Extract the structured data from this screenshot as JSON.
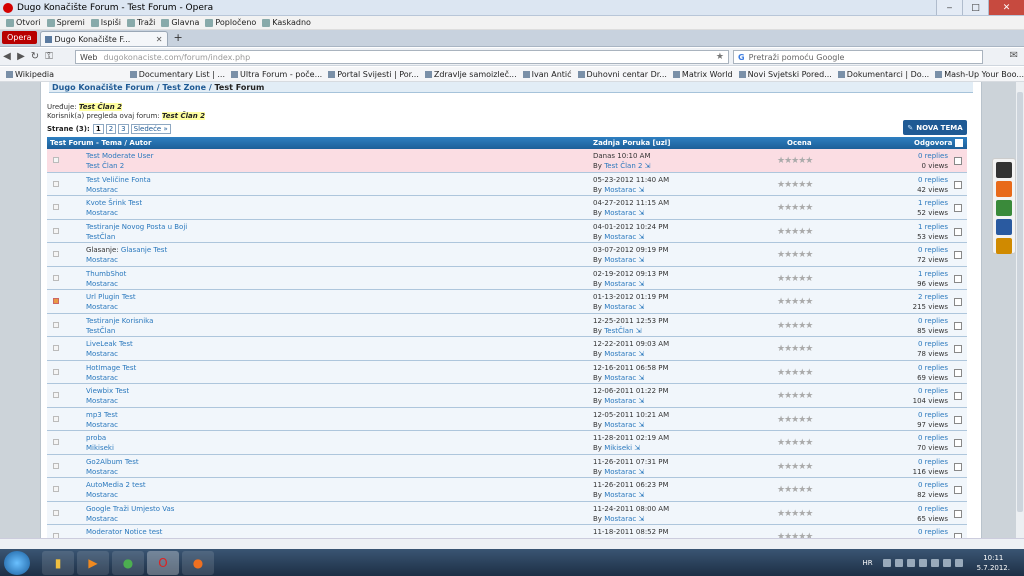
{
  "window": {
    "title": "Dugo Konačište Forum - Test Forum - Opera"
  },
  "menu": [
    "Otvori",
    "Spremi",
    "Ispiši",
    "Traži",
    "Glavna",
    "Popločeno",
    "Kaskadno"
  ],
  "browser": {
    "opera_label": "Opera",
    "tab_title": "Dugo Konačište F...",
    "web_label": "Web",
    "url": "dugokonaciste.com/forum/index.php",
    "search_placeholder": "Pretraži pomoću Google"
  },
  "bookmarks": [
    "Wikipedia",
    "",
    "Documentary List | ...",
    "Ultra Forum - poče...",
    "Portal Svijesti | Por...",
    "Zdravlje samoizleč...",
    "Ivan Antić",
    "Duhovni centar Dr...",
    "Matrix World",
    "Novi Svjetski Pored...",
    "Dokumentarci | Do...",
    "Mash-Up Your Boo..."
  ],
  "breadcrumb": {
    "root": "Dugo Konačište Forum",
    "parent": "Test Zone",
    "current": "Test Forum",
    "sep": "/"
  },
  "moderators": {
    "label": "Uređuje:",
    "name": "Test Član 2",
    "viewing_text": "Korisnik(a) pregleda ovaj forum:",
    "viewer": "Test Član 2"
  },
  "pagination": {
    "label": "Strane (3):",
    "pages": [
      "1",
      "2",
      "3"
    ],
    "next": "Sledeće »"
  },
  "new_topic_label": "NOVA TEMA",
  "table_header": {
    "topic": "Test Forum - Tema / Autor",
    "last_post": "Zadnja Poruka [uzl]",
    "rating": "Ocena",
    "replies": "Odgovora"
  },
  "topics": [
    {
      "title": "Test Moderate User",
      "author": "Test Član 2",
      "date": "Danas 10:10 AM",
      "by": "Test Član 2",
      "replies": "0 replies",
      "views": "0 views"
    },
    {
      "title": "Test Veličine Fonta",
      "author": "Mostarac",
      "date": "05-23-2012 11:40 AM",
      "by": "Mostarac",
      "replies": "0 replies",
      "views": "42 views"
    },
    {
      "title": "Kvote Šrink Test",
      "author": "Mostarac",
      "date": "04-27-2012 11:15 AM",
      "by": "Mostarac",
      "replies": "1 replies",
      "views": "52 views"
    },
    {
      "title": "Testiranje Novog Posta u Boji",
      "author": "TestČlan",
      "date": "04-01-2012 10:24 PM",
      "by": "Mostarac",
      "replies": "1 replies",
      "views": "53 views"
    },
    {
      "title": "Glasanje Test",
      "prefix": "Glasanje:",
      "author": "Mostarac",
      "date": "03-07-2012 09:19 PM",
      "by": "Mostarac",
      "replies": "0 replies",
      "views": "72 views"
    },
    {
      "title": "ThumbShot",
      "author": "Mostarac",
      "date": "02-19-2012 09:13 PM",
      "by": "Mostarac",
      "replies": "1 replies",
      "views": "96 views"
    },
    {
      "title": "Url Plugin Test",
      "author": "Mostarac",
      "date": "01-13-2012 01:19 PM",
      "by": "Mostarac",
      "replies": "2 replies",
      "views": "215 views"
    },
    {
      "title": "Testiranje Korisnika",
      "author": "TestČlan",
      "date": "12-25-2011 12:53 PM",
      "by": "TestČlan",
      "replies": "0 replies",
      "views": "85 views"
    },
    {
      "title": "LiveLeak Test",
      "author": "Mostarac",
      "date": "12-22-2011 09:03 AM",
      "by": "Mostarac",
      "replies": "0 replies",
      "views": "78 views"
    },
    {
      "title": "HotImage Test",
      "author": "Mostarac",
      "date": "12-16-2011 06:58 PM",
      "by": "Mostarac",
      "replies": "0 replies",
      "views": "69 views"
    },
    {
      "title": "Viewbix Test",
      "author": "Mostarac",
      "date": "12-06-2011 01:22 PM",
      "by": "Mostarac",
      "replies": "0 replies",
      "views": "104 views"
    },
    {
      "title": "mp3 Test",
      "author": "Mostarac",
      "date": "12-05-2011 10:21 AM",
      "by": "Mostarac",
      "replies": "0 replies",
      "views": "97 views"
    },
    {
      "title": "proba",
      "author": "Mikiseki",
      "date": "11-28-2011 02:19 AM",
      "by": "Mikiseki",
      "replies": "0 replies",
      "views": "70 views"
    },
    {
      "title": "Go2Album Test",
      "author": "Mostarac",
      "date": "11-26-2011 07:31 PM",
      "by": "Mostarac",
      "replies": "0 replies",
      "views": "116 views"
    },
    {
      "title": "AutoMedia 2 test",
      "author": "Mostarac",
      "date": "11-26-2011 06:23 PM",
      "by": "Mostarac",
      "replies": "0 replies",
      "views": "82 views"
    },
    {
      "title": "Google Traži Umjesto Vas",
      "author": "Mostarac",
      "date": "11-24-2011 08:00 AM",
      "by": "Mostarac",
      "replies": "0 replies",
      "views": "65 views"
    },
    {
      "title": "Moderator Notice test",
      "author": "Mostarac",
      "date": "11-18-2011 08:52 PM",
      "by": "Mostarac",
      "replies": "0 replies",
      "views": ""
    }
  ],
  "by_label": "By",
  "taskbar": {
    "lang": "HR",
    "time": "10:11",
    "date": "5.7.2012."
  },
  "colors": {
    "header_blue": "#1d5f98",
    "link": "#2a78bd",
    "pink_row": "#fbdde3"
  }
}
